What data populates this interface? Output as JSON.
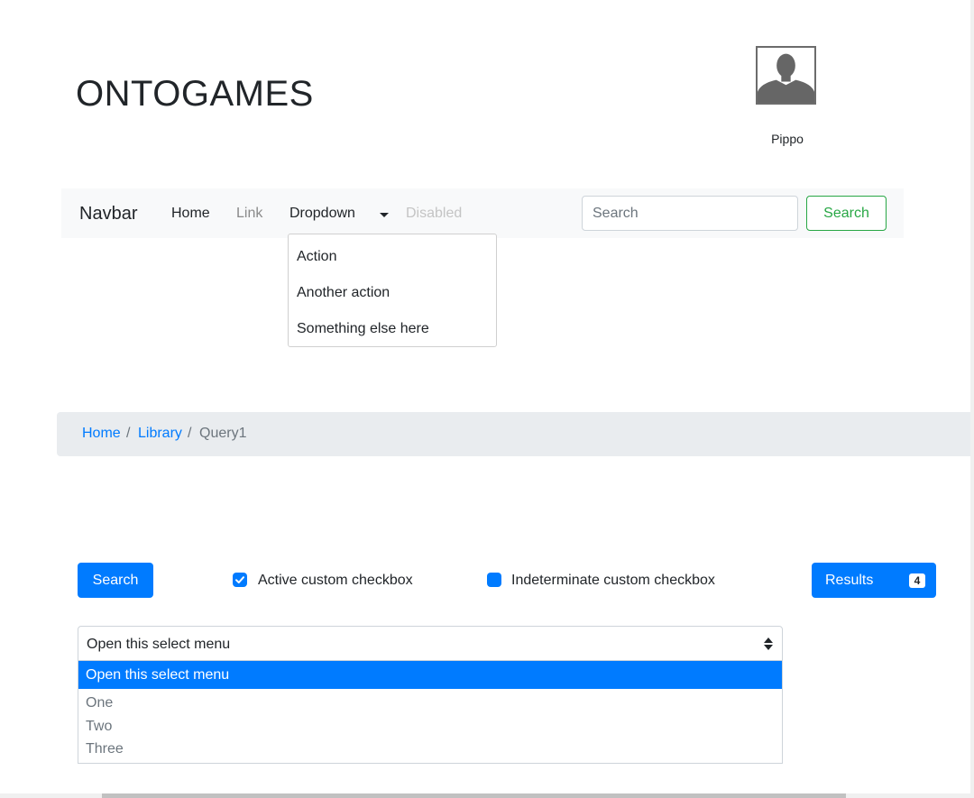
{
  "header": {
    "title": "ONTOGAMES",
    "user": {
      "avatar_icon": "user-silhouette-icon",
      "name": "Pippo"
    }
  },
  "navbar": {
    "brand": "Navbar",
    "links": [
      {
        "label": "Home",
        "state": "active"
      },
      {
        "label": "Link",
        "state": "normal"
      },
      {
        "label": "Dropdown",
        "state": "open"
      },
      {
        "label": "Disabled",
        "state": "disabled"
      }
    ],
    "search": {
      "placeholder": "Search",
      "value": "",
      "button_label": "Search"
    },
    "dropdown_items": [
      "Action",
      "Another action",
      "Something else here"
    ]
  },
  "breadcrumb": {
    "items": [
      "Home",
      "Library",
      "Query1"
    ],
    "separator": "/"
  },
  "controls": {
    "search_button": "Search",
    "checkbox_active": {
      "label": "Active custom checkbox",
      "checked": true
    },
    "checkbox_indeterminate": {
      "label": "Indeterminate custom checkbox",
      "state": "indeterminate"
    },
    "results": {
      "label": "Results",
      "count": "4"
    }
  },
  "select": {
    "value": "Open this select menu",
    "options": [
      "Open this select menu",
      "One",
      "Two",
      "Three"
    ],
    "highlighted_index": 0
  },
  "colors": {
    "primary": "#007bff",
    "success": "#28a745",
    "navbar_bg": "#f8f9fa",
    "breadcrumb_bg": "#e9ecef",
    "muted": "#6c757d"
  }
}
